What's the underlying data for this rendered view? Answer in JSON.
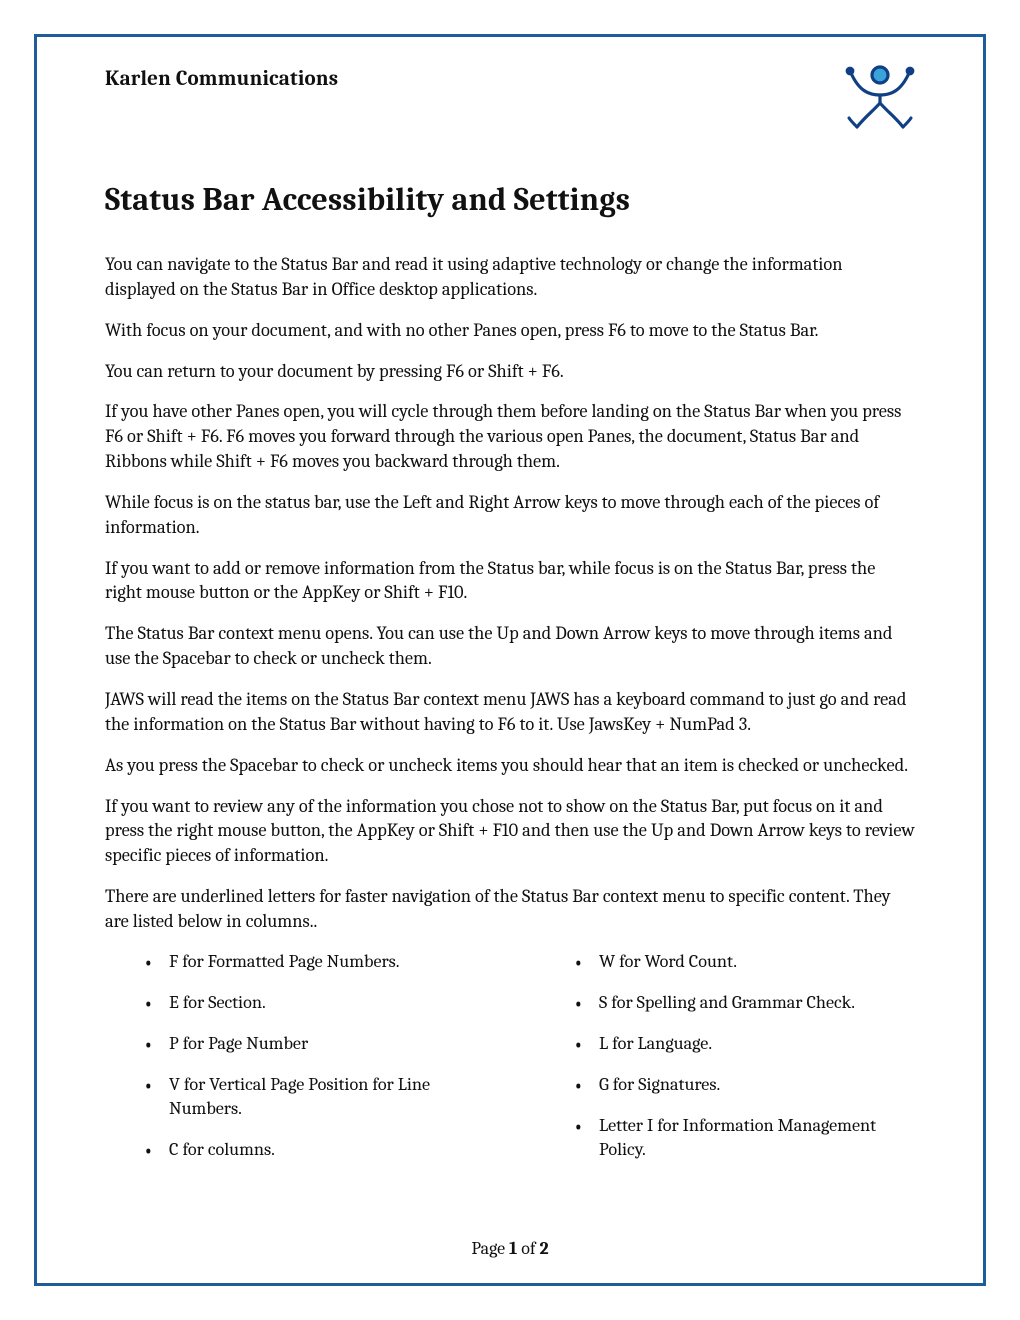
{
  "header": {
    "org": "Karlen Communications",
    "logo_name": "accessibility-person-icon"
  },
  "title": "Status Bar Accessibility and Settings",
  "paragraphs": [
    "You can navigate to the Status Bar and read it using adaptive technology or change the information displayed on the Status Bar in Office desktop applications.",
    "With focus on your document, and with no other Panes open, press F6 to move to the Status Bar.",
    "You can return to your document by pressing F6 or Shift + F6.",
    "If you have other Panes open, you will cycle through them before landing on the Status Bar when you press F6 or Shift + F6. F6 moves you forward through the various open Panes, the document, Status Bar and Ribbons while Shift + F6 moves you backward through them.",
    "While focus is on the status bar, use the Left and Right Arrow keys to move through each of the pieces of information.",
    "If you want to add or remove information from the Status bar, while focus is on the Status Bar, press the right mouse button or the AppKey or Shift + F10.",
    "The Status Bar context menu opens. You can use the Up and Down Arrow keys to move through items and use the Spacebar to check or uncheck them.",
    "JAWS will read the items on the Status Bar context menu JAWS has a keyboard command to just go and read the information on the Status Bar without having to F6 to it. Use JawsKey + NumPad 3.",
    "As you press the Spacebar to check or uncheck items you should hear that an item is checked or unchecked.",
    "If you want to review any of the information you chose not to show on the Status Bar, put focus on it and press the right mouse button, the AppKey or Shift + F10 and then use the Up and Down Arrow keys to review specific pieces of information.",
    "There are underlined letters for faster navigation of the Status Bar context menu to specific content. They are listed below in columns.."
  ],
  "columns": {
    "left": [
      "F for Formatted Page Numbers.",
      "E for Section.",
      "P for Page Number",
      "V for Vertical Page Position for Line Numbers.",
      "C for columns."
    ],
    "right": [
      "W for Word Count.",
      "S for Spelling and Grammar Check.",
      "L for Language.",
      "G for Signatures.",
      "Letter I for Information Management Policy."
    ]
  },
  "footer": {
    "prefix": "Page ",
    "current": "1",
    "of": " of ",
    "total": "2"
  }
}
